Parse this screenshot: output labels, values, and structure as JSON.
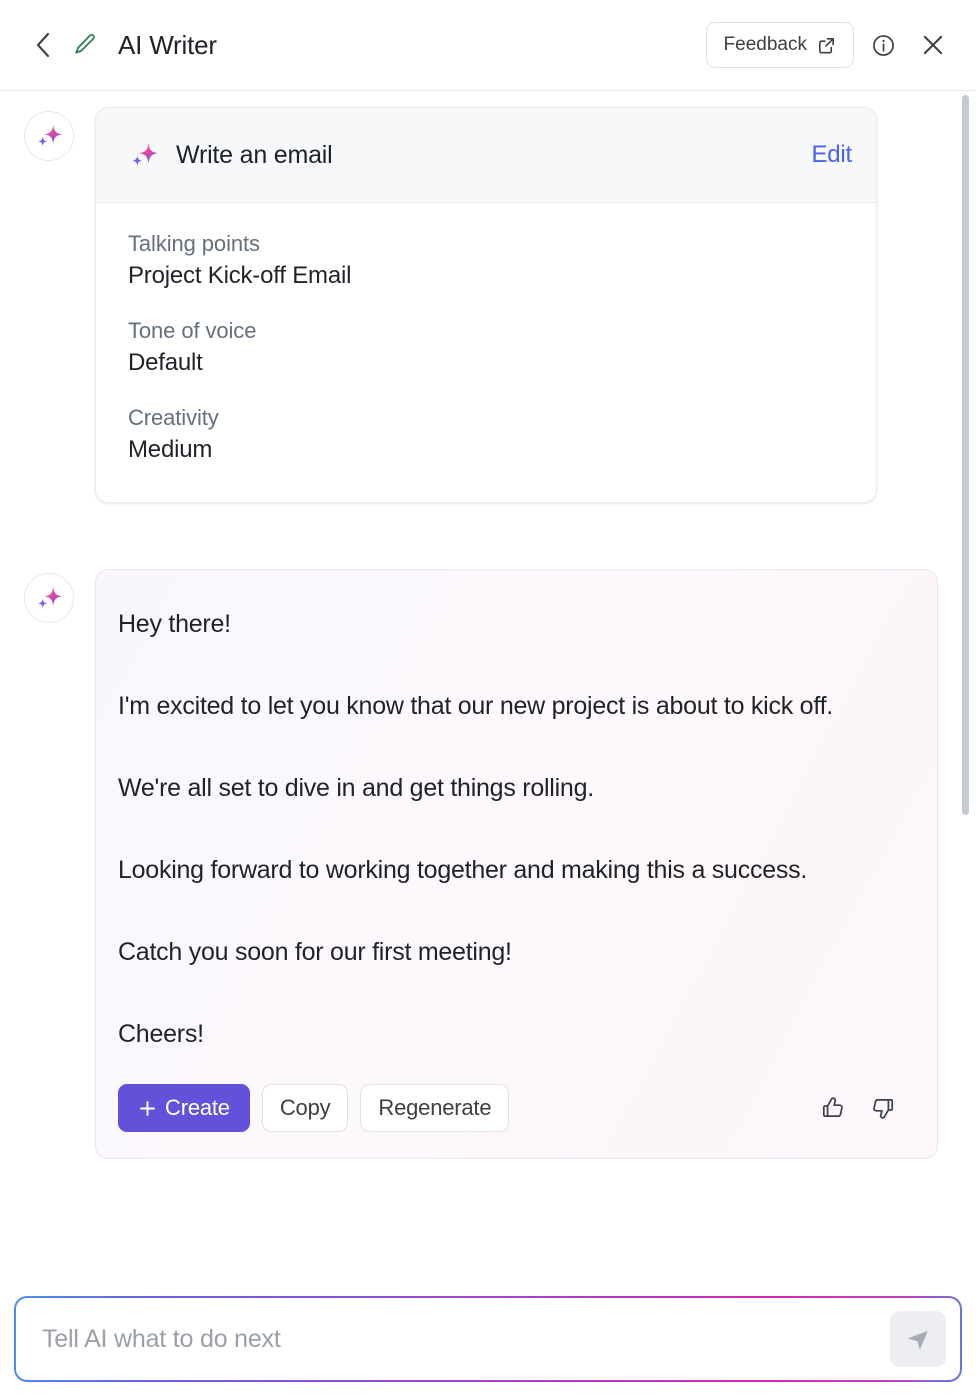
{
  "header": {
    "back_icon": "chevron-left-icon",
    "pencil_icon": "pencil-icon",
    "title": "AI Writer",
    "feedback_label": "Feedback",
    "feedback_icon": "external-link-icon",
    "info_icon": "info-circle-icon",
    "close_icon": "close-icon",
    "pencil_color": "#2f8254"
  },
  "prompt_card": {
    "sparkle_icon": "sparkle-icon",
    "title": "Write an email",
    "edit_label": "Edit",
    "edit_color": "#4a62f0",
    "fields": [
      {
        "label": "Talking points",
        "value": "Project Kick-off Email"
      },
      {
        "label": "Tone of voice",
        "value": "Default"
      },
      {
        "label": "Creativity",
        "value": "Medium"
      }
    ]
  },
  "answer": {
    "avatar_icon": "sparkle-icon",
    "paragraphs": [
      "Hey there!",
      "I'm excited to let you know that our new project is about to kick off.",
      "We're all set to dive in and get things rolling.",
      "Looking forward to working together and making this a success.",
      "Catch you soon for our first meeting!",
      "Cheers!"
    ],
    "actions": {
      "create_label": "Create",
      "create_icon": "plus-icon",
      "create_color": "#6352d9",
      "copy_label": "Copy",
      "regenerate_label": "Regenerate",
      "thumbs_up_icon": "thumbs-up-icon",
      "thumbs_down_icon": "thumbs-down-icon"
    }
  },
  "composer": {
    "placeholder": "Tell AI what to do next",
    "value": "",
    "send_icon": "send-icon"
  }
}
